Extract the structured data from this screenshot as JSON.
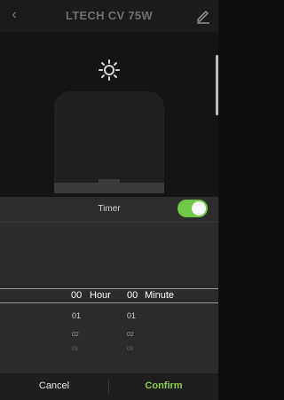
{
  "header": {
    "title": "LTECH CV 75W",
    "back_icon": "‹"
  },
  "timer": {
    "label": "Timer",
    "enabled": true
  },
  "picker": {
    "hour_selected": "00",
    "hour_label": "Hour",
    "hour_next": "01",
    "hour_next2": "02",
    "hour_next3": "03",
    "minute_selected": "00",
    "minute_label": "Minute",
    "minute_next": "01",
    "minute_next2": "02",
    "minute_next3": "03"
  },
  "footer": {
    "cancel_label": "Cancel",
    "confirm_label": "Confirm"
  },
  "colors": {
    "accent": "#8fcf50",
    "toggle": "#70c848"
  }
}
